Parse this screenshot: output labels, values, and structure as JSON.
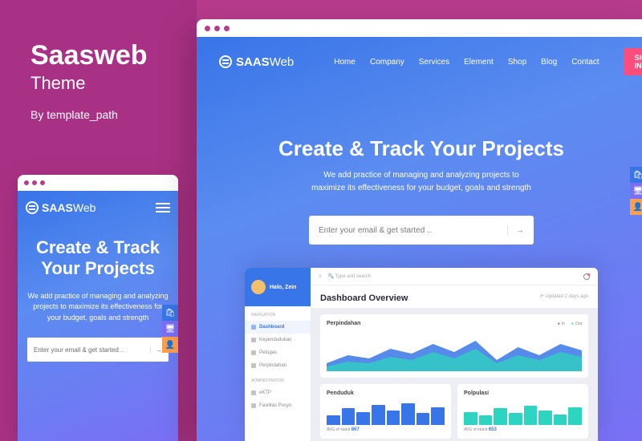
{
  "title": {
    "main": "Saasweb",
    "sub": "Theme",
    "by": "By template_path"
  },
  "brand": {
    "name": "SAAS",
    "suffix": "Web"
  },
  "hero": {
    "headline": "Create & Track Your Projects",
    "sub": "We add practice of managing and analyzing projects to maximize its effectiveness for your budget, goals and strength",
    "placeholder": "Enter your email & get started ..",
    "arrow": "→"
  },
  "nav": [
    "Home",
    "Company",
    "Services",
    "Element",
    "Shop",
    "Blog",
    "Contact"
  ],
  "signin": "SIGN IN",
  "dashboard": {
    "profile": "Halo, Zein",
    "search": "🔍  Type and search",
    "section1": "NAVIGATION",
    "section2": "ADMINISTRATOR",
    "items1": [
      "Dashboard",
      "Kependudukan",
      "Petugas",
      "Perpindahan"
    ],
    "items2": [
      "eKTP",
      "Fasilitas Posyo"
    ],
    "title": "Dashboard Overview",
    "updated": "⟳ Updated 2 days ago",
    "card1": {
      "title": "Perpindahan",
      "legend": [
        "In",
        "Out"
      ]
    },
    "card2": {
      "title": "Penduduk",
      "stat_label": "AVG of stand",
      "stat_val": "867"
    },
    "card3": {
      "title": "Polpulasi",
      "stat_label": "AVG of stand",
      "stat_val": "653"
    }
  },
  "colors": {
    "accent": "#3875e8",
    "pink": "#ff4d7e",
    "teal": "#2dd4bf"
  },
  "chart_data": {
    "type": "area",
    "series": [
      {
        "name": "In",
        "color": "#3875e8",
        "values": [
          15,
          28,
          22,
          40,
          30,
          50,
          35,
          55,
          20,
          42,
          28,
          48
        ]
      },
      {
        "name": "Out",
        "color": "#2dd4bf",
        "values": [
          10,
          18,
          14,
          26,
          20,
          34,
          24,
          38,
          14,
          30,
          20,
          34
        ]
      }
    ]
  },
  "icons": {
    "bag": "🛍",
    "monitor": "🖥",
    "user": "👤"
  }
}
